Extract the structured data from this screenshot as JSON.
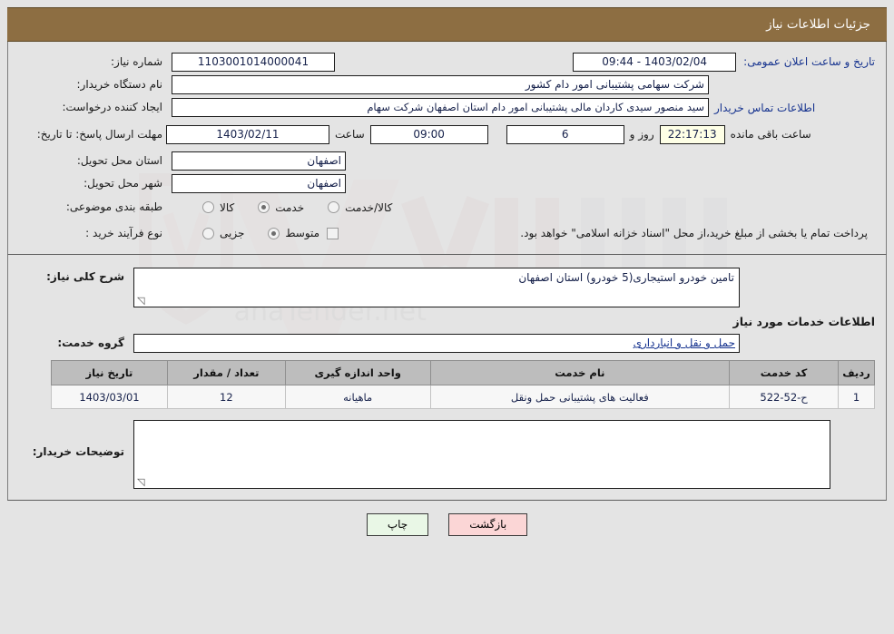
{
  "header": {
    "title": "جزئیات اطلاعات نیاز"
  },
  "form": {
    "need_number_label": "شماره نیاز:",
    "need_number_value": "1103001014000041",
    "announce_datetime_label": "تاریخ و ساعت اعلان عمومی:",
    "announce_datetime_value": "1403/02/04 - 09:44",
    "buyer_org_label": "نام دستگاه خریدار:",
    "buyer_org_value": "شرکت سهامی پشتیبانی امور دام کشور",
    "requester_label": "ایجاد کننده درخواست:",
    "requester_value": "سید منصور سیدی کاردان مالی پشتیبانی امور دام استان اصفهان شرکت سهام",
    "buyer_contact_link": "اطلاعات تماس خریدار",
    "deadline_label": "مهلت ارسال پاسخ: تا تاریخ:",
    "deadline_date": "1403/02/11",
    "deadline_time_label": "ساعت",
    "deadline_time": "09:00",
    "remaining_days": "6",
    "remaining_days_label": "روز و",
    "remaining_clock": "22:17:13",
    "remaining_clock_label": "ساعت باقی مانده",
    "province_label": "استان محل تحویل:",
    "province_value": "اصفهان",
    "city_label": "شهر محل تحویل:",
    "city_value": "اصفهان",
    "category_label": "طبقه بندی موضوعی:",
    "category_options": [
      {
        "label": "کالا",
        "selected": false
      },
      {
        "label": "خدمت",
        "selected": true
      },
      {
        "label": "کالا/خدمت",
        "selected": false
      }
    ],
    "process_label": "نوع فرآیند خرید :",
    "process_options": [
      {
        "label": "جزیی",
        "selected": false
      },
      {
        "label": "متوسط",
        "selected": true
      }
    ],
    "treasury_checkbox_checked": false,
    "treasury_note": "پرداخت تمام یا بخشی از مبلغ خرید،از محل \"اسناد خزانه اسلامی\" خواهد بود."
  },
  "description": {
    "label": "شرح کلی نیاز:",
    "value": "تامین خودرو استیجاری(5 خودرو) استان اصفهان"
  },
  "services": {
    "section_title": "اطلاعات خدمات مورد نیاز",
    "group_label": "گروه خدمت:",
    "group_value": "حمل و نقل و انبارداری",
    "columns": [
      "ردیف",
      "کد خدمت",
      "نام خدمت",
      "واحد اندازه گیری",
      "تعداد / مقدار",
      "تاریخ نیاز"
    ],
    "rows": [
      {
        "radif": "1",
        "code": "ح-52-522",
        "name": "فعالیت های پشتیبانی حمل ونقل",
        "unit": "ماهیانه",
        "qty": "12",
        "date": "1403/03/01"
      }
    ]
  },
  "comments": {
    "label": "توضیحات خریدار:",
    "value": ""
  },
  "footer": {
    "print_label": "چاپ",
    "back_label": "بازگشت"
  },
  "colors": {
    "title_bar": "#8d6e42",
    "page_bg": "#e4e4e4",
    "link": "#16338f",
    "table_header": "#bdbdbd",
    "print_btn": "#e9f7e6",
    "back_btn": "#fbd6d6"
  }
}
